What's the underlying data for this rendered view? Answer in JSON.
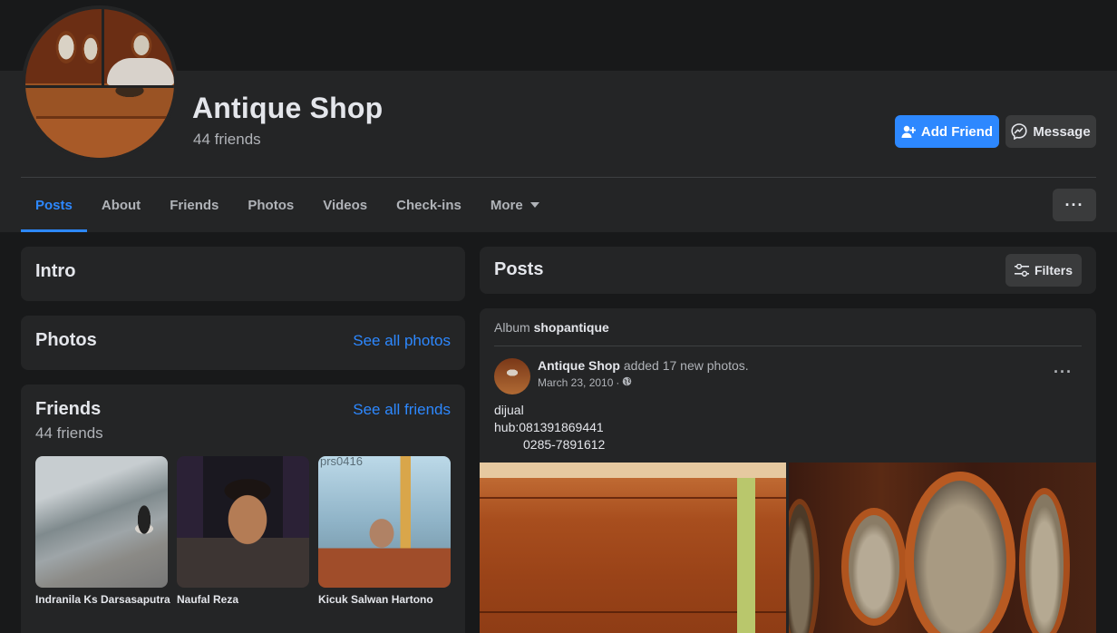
{
  "profile": {
    "name": "Antique Shop",
    "friends_count": "44 friends"
  },
  "actions": {
    "add_friend": "Add Friend",
    "message": "Message",
    "more": "···"
  },
  "tabs": [
    {
      "label": "Posts",
      "active": true
    },
    {
      "label": "About"
    },
    {
      "label": "Friends"
    },
    {
      "label": "Photos"
    },
    {
      "label": "Videos"
    },
    {
      "label": "Check-ins"
    },
    {
      "label": "More"
    }
  ],
  "intro": {
    "title": "Intro"
  },
  "photos": {
    "title": "Photos",
    "link": "See all photos"
  },
  "friends": {
    "title": "Friends",
    "count": "44 friends",
    "link": "See all friends",
    "items": [
      {
        "name": "Indranila Ks Darsasaputra"
      },
      {
        "name": "Naufal Reza"
      },
      {
        "name": "Kicuk Salwan Hartono",
        "photo_text": "prs0416"
      }
    ]
  },
  "posts": {
    "title": "Posts",
    "filters": "Filters"
  },
  "post": {
    "album_prefix": "Album",
    "album_name": "shopantique",
    "author": "Antique Shop",
    "action": "added 17 new photos.",
    "date": "March 23, 2010",
    "dot": "·",
    "options": "···",
    "text_lines": [
      "dijual",
      "hub:081391869441",
      "0285-7891612"
    ]
  },
  "colors": {
    "background": "#18191a",
    "card": "#242526",
    "accent": "#2d88ff",
    "button": "#3a3b3c",
    "text_primary": "#e4e6eb",
    "text_secondary": "#b0b3b8"
  }
}
